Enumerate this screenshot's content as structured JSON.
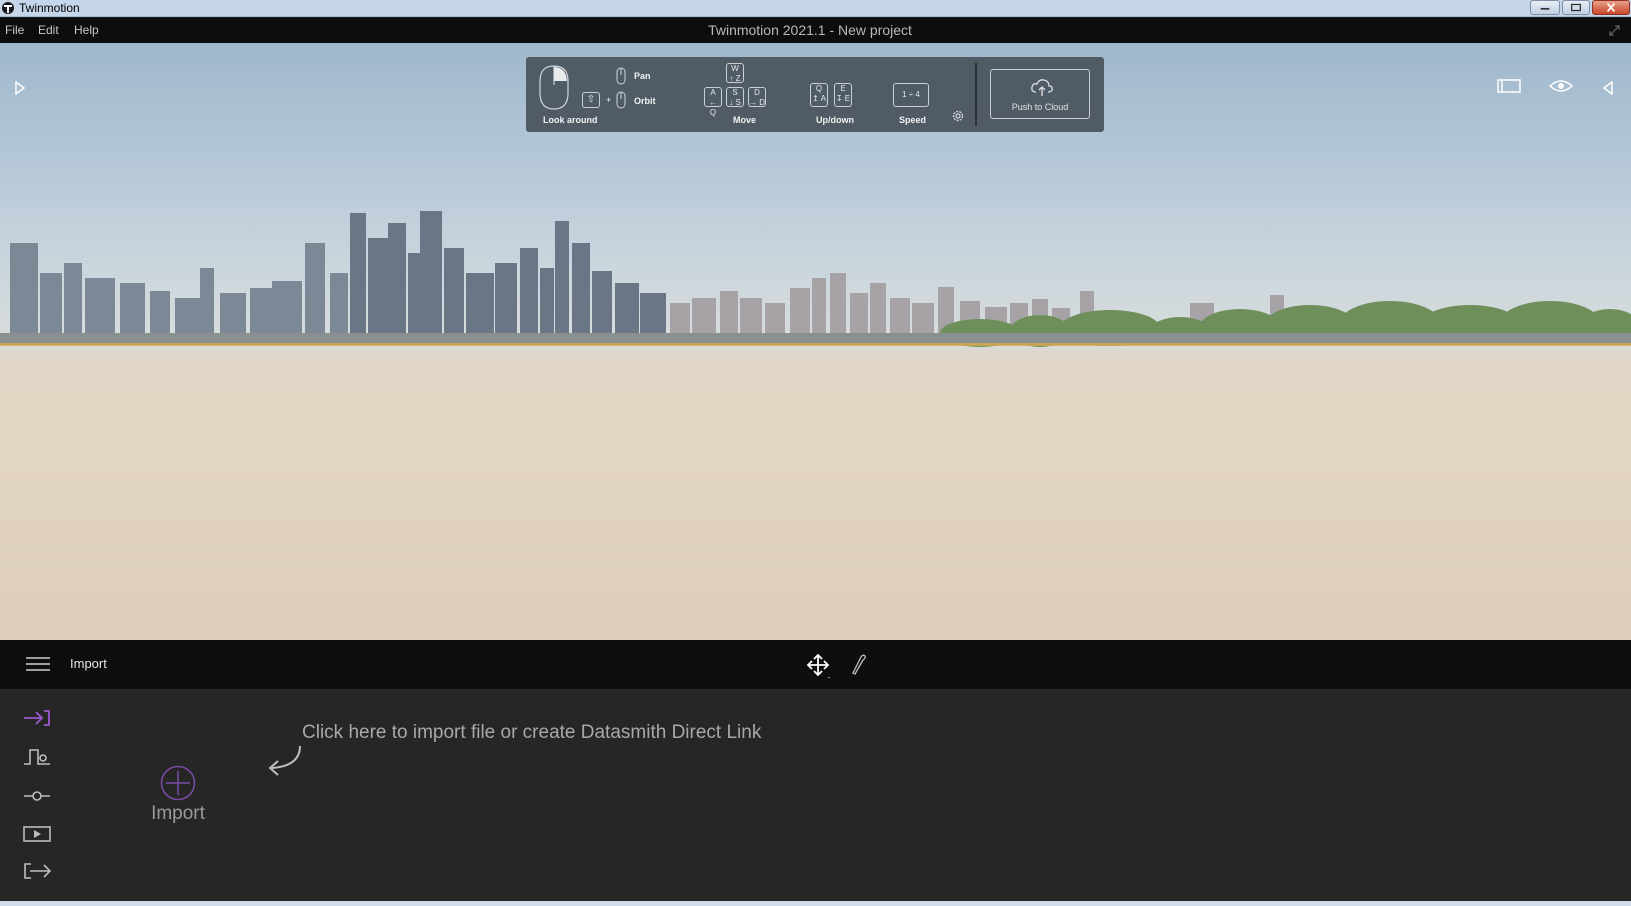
{
  "window": {
    "app_name": "Twinmotion",
    "title": "Twinmotion 2021.1 - New project"
  },
  "menu": {
    "items": [
      "File",
      "Edit",
      "Help"
    ]
  },
  "nav_help": {
    "look_around": "Look around",
    "pan": "Pan",
    "orbit": "Orbit",
    "shift_key": "⇧",
    "move": "Move",
    "updown": "Up/down",
    "speed": "Speed",
    "speed_keys": "1 ÷ 4",
    "push_to_cloud": "Push to Cloud",
    "keys": {
      "w": "W",
      "w_sub": "↑ Z",
      "a": "A",
      "a_sub": "← Q",
      "s": "S",
      "s_sub": "↓ S",
      "d": "D",
      "d_sub": "→ D",
      "q": "Q",
      "q_sub": "↥ A",
      "e": "E",
      "e_sub": "↧ E"
    }
  },
  "bottom": {
    "section_title": "Import",
    "hint": "Click here to import file or create Datasmith Direct Link",
    "import_label": "Import"
  },
  "colors": {
    "accent": "#9b59d0",
    "panel_bg": "#262626",
    "toolbar_bg": "#0e0e0e"
  }
}
